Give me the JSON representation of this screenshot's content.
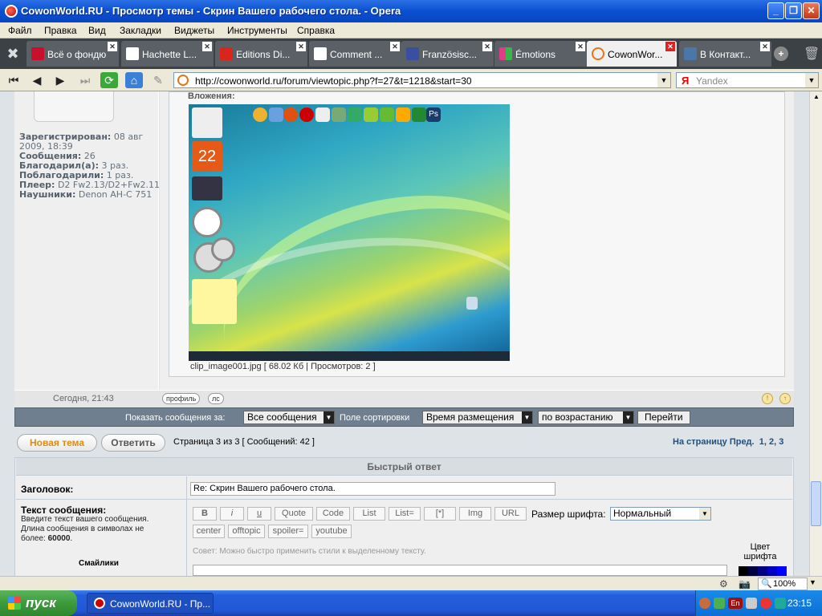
{
  "window": {
    "title": "CowonWorld.RU - Просмотр темы - Скрин Вашего рабочего стола. - Opera",
    "min_label": "_",
    "max_label": "❐",
    "close_label": "✕"
  },
  "menu": [
    "Файл",
    "Правка",
    "Вид",
    "Закладки",
    "Виджеты",
    "Инструменты",
    "Справка"
  ],
  "tabs": [
    {
      "label": "Всё о фондю",
      "fav_color": "#c8102e",
      "active": false
    },
    {
      "label": "Hachette L...",
      "fav_color": "#ffffff",
      "active": false
    },
    {
      "label": "Editions Di...",
      "fav_color": "#d9261c",
      "active": false
    },
    {
      "label": "Comment ...",
      "fav_color": "#ffffff",
      "active": false
    },
    {
      "label": "Französisc...",
      "fav_color": "#3a4fa0",
      "active": false
    },
    {
      "label": "Émotions",
      "fav_color": "#e23b8a",
      "active": false
    },
    {
      "label": "CowonWor...",
      "fav_color": "#e8731a",
      "active": true
    },
    {
      "label": "В Контакт...",
      "fav_color": "#4a76a8",
      "active": false
    }
  ],
  "address": {
    "url": "http://cowonworld.ru/forum/viewtopic.php?f=27&t=1218&start=30",
    "search_engine": "Я",
    "search_placeholder": "Yandex"
  },
  "post": {
    "attachments_label": "Вложения:",
    "profile": [
      {
        "k": "Зарегистрирован:",
        "v": " 08 авг"
      },
      {
        "k": "",
        "v": "2009, 18:39"
      },
      {
        "k": "Сообщения:",
        "v": " 26"
      },
      {
        "k": "Благодарил(а):",
        "v": " 3 раз."
      },
      {
        "k": "Поблагодарили:",
        "v": " 1 раз."
      },
      {
        "k": "Плеер:",
        "v": " D2 Fw2.13/D2+Fw2.11"
      },
      {
        "k": "Наушники:",
        "v": " Denon AH-C 751"
      }
    ],
    "image_caption": "clip_image001.jpg [ 68.02 Кб | Просмотров: 2 ]",
    "calendar_day": "22",
    "date": "Сегодня, 21:43",
    "profile_btn": "профиль",
    "pm_btn": "лс"
  },
  "sortbar": {
    "show_label": "Показать сообщения за:",
    "show_value": "Все сообщения",
    "sort_label": "Поле сортировки",
    "sort_value": "Время размещения",
    "order_value": "по возрастанию",
    "go_label": "Перейти"
  },
  "pagination": {
    "new_topic": "Новая тема",
    "reply": "Ответить",
    "info": "Страница 3 из 3   [ Сообщений: 42 ]",
    "nav_prefix": "На страницу",
    "nav_prev": "Пред.",
    "pages": [
      "1",
      "2",
      "3"
    ]
  },
  "quick_reply": {
    "title": "Быстрый ответ",
    "subject_label": "Заголовок:",
    "subject_value": "Re: Скрин Вашего рабочего стола.",
    "text_label": "Текст сообщения:",
    "text_desc_1": "Введите текст вашего сообщения.",
    "text_desc_2": "Длина сообщения в символах не",
    "text_desc_3": "более: ",
    "text_desc_limit": "60000",
    "smilies_label": "Смайлики",
    "format_buttons_row1": [
      "B",
      "i",
      "u",
      "Quote",
      "Code",
      "List",
      "List=",
      "[*]",
      "Img",
      "URL"
    ],
    "font_size_label": "Размер шрифта:",
    "font_size_value": "Нормальный",
    "format_buttons_row2": [
      "center",
      "offtopic",
      "spoiler=",
      "youtube"
    ],
    "hint": "Совет: Можно быстро применить стили к выделенному тексту.",
    "color_label_1": "Цвет",
    "color_label_2": "шрифта"
  },
  "status": {
    "zoom": "100%"
  },
  "taskbar": {
    "start": "пуск",
    "task_label": "CowonWorld.RU - Пр...",
    "lang": "En",
    "time": "23:15"
  },
  "colors": {
    "opera_red": "#cc0f16",
    "link_blue": "#205080",
    "xp_blue": "#245edb",
    "start_green": "#3c9a3c"
  }
}
